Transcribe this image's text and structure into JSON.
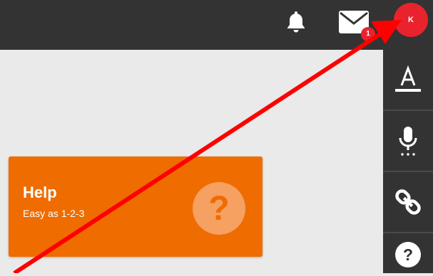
{
  "topbar": {
    "notifications_icon": "bell-icon",
    "messages_icon": "envelope-icon",
    "messages_badge": "1",
    "avatar_initial": "K"
  },
  "rail": {
    "items": [
      {
        "icon": "text-format-icon"
      },
      {
        "icon": "microphone-icon"
      },
      {
        "icon": "link-icon"
      },
      {
        "icon": "help-icon"
      }
    ]
  },
  "help_card": {
    "title": "Help",
    "subtitle": "Easy as 1-2-3",
    "icon": "question-mark-icon"
  },
  "colors": {
    "topbar_bg": "#333333",
    "page_bg": "#eaeaea",
    "card_bg": "#ef6c00",
    "accent_red": "#e8232e"
  }
}
